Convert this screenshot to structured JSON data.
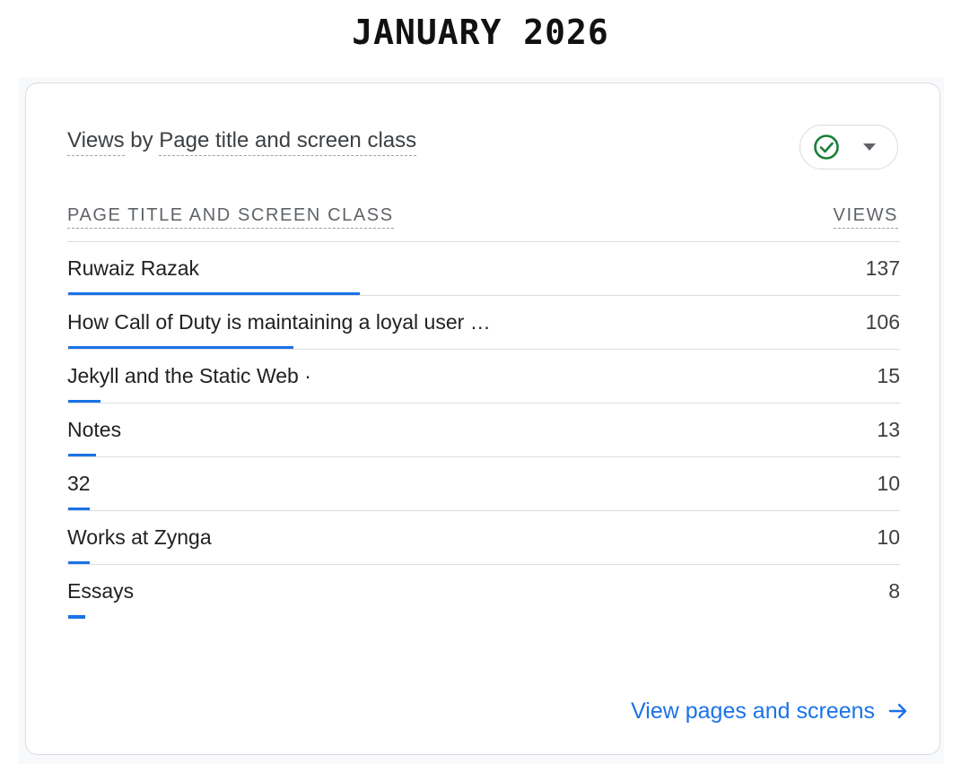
{
  "heading": "JANUARY 2026",
  "card": {
    "title_part1": "Views",
    "title_part2": "by",
    "title_part3": "Page title and screen class",
    "compare_icon": "check-circle-icon",
    "compare_dropdown_icon": "caret-down-icon",
    "columns": {
      "name": "PAGE TITLE AND SCREEN CLASS",
      "views": "VIEWS"
    },
    "rows": [
      {
        "label": "Ruwaiz Razak",
        "value": "137",
        "views": 137
      },
      {
        "label": "How Call of Duty is maintaining a loyal user …",
        "value": "106",
        "views": 106
      },
      {
        "label": "Jekyll and the Static Web ·",
        "value": "15",
        "views": 15
      },
      {
        "label": "Notes",
        "value": "13",
        "views": 13
      },
      {
        "label": "32",
        "value": "10",
        "views": 10
      },
      {
        "label": "Works at Zynga",
        "value": "10",
        "views": 10
      },
      {
        "label": "Essays",
        "value": "8",
        "views": 8
      }
    ],
    "link_text": "View pages and screens",
    "link_icon": "arrow-right-icon"
  },
  "colors": {
    "accent": "#1a73e8",
    "check_green": "#188038"
  }
}
